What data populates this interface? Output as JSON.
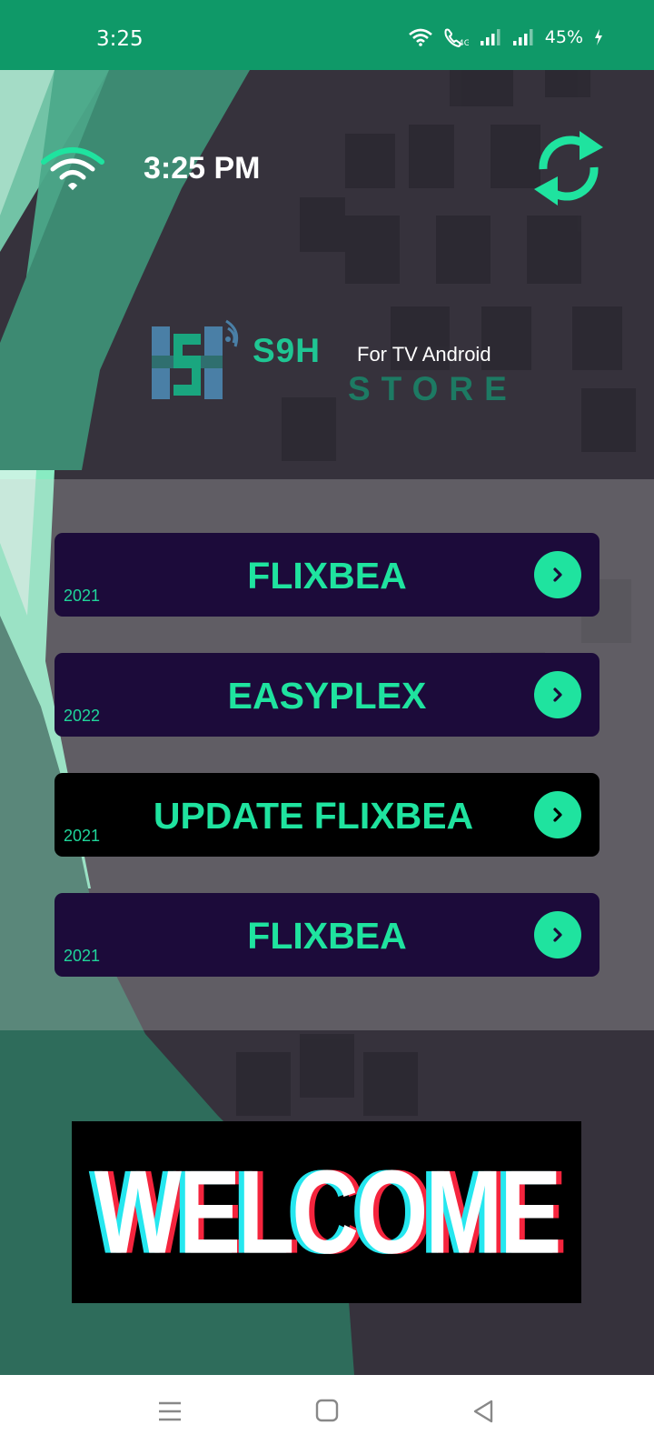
{
  "status_bar": {
    "time": "3:25",
    "battery": "45%",
    "icons": [
      "wifi-icon",
      "volte-call-icon",
      "signal-icon",
      "signal-icon",
      "charging-icon"
    ]
  },
  "header": {
    "clock": "3:25 PM",
    "wifi_icon": "wifi-icon",
    "refresh_icon": "refresh-icon"
  },
  "logo": {
    "brand": "S9H",
    "tagline": "For TV Android",
    "store": "STORE"
  },
  "menu": [
    {
      "title": "FLIXBEA",
      "year": "2021"
    },
    {
      "title": "EASYPLEX",
      "year": "2022"
    },
    {
      "title": "UPDATE FLIXBEA",
      "year": "2021"
    },
    {
      "title": "FLIXBEA",
      "year": "2021"
    }
  ],
  "banner": {
    "text": "WELCOME"
  },
  "nav": [
    "menu-icon",
    "home-icon",
    "back-icon"
  ],
  "colors": {
    "status_bar": "#0f9968",
    "accent": "#1fe39f",
    "background": "#36323c",
    "button": "#1c0b3a"
  }
}
